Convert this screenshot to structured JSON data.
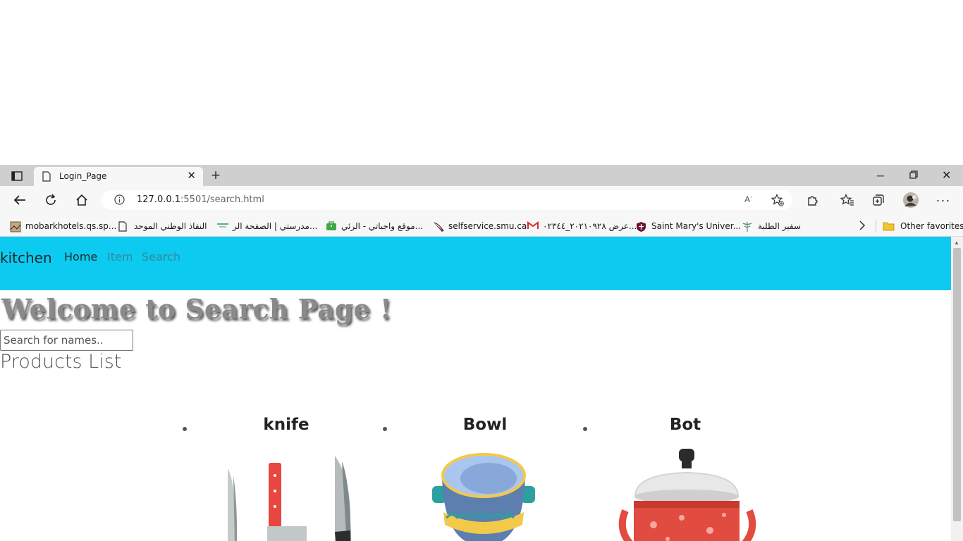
{
  "browser": {
    "tab_title": "Login_Page",
    "url_host": "127.0.0.1",
    "url_path": ":5501/search.html",
    "read_aloud": "Aʾ",
    "bookmarks": [
      {
        "label": "mobarkhotels.qs.sp...",
        "icon": "image-icon"
      },
      {
        "label": "النفاذ الوطني الموحد",
        "icon": "page-icon"
      },
      {
        "label": "مدرستي | الصفحة الر...",
        "icon": "school-icon"
      },
      {
        "label": "موقع واجباتي - الرئي...",
        "icon": "briefcase-icon"
      },
      {
        "label": "selfservice.smu.ca",
        "icon": "feather-icon"
      },
      {
        "label": "عرض ٢٠٢١٠٩٢٨_٠٢٣٤٤...",
        "icon": "gmail-icon"
      },
      {
        "label": "Saint Mary's Univer...",
        "icon": "shield-icon"
      },
      {
        "label": "سفير الطلبة",
        "icon": "caduceus-icon"
      }
    ],
    "other_favorites": "Other favorites"
  },
  "page": {
    "brand": "kitchen",
    "nav": [
      "Home",
      "Item",
      "Search"
    ],
    "welcome": "Welcome to Search Page !",
    "search_placeholder": "Search for names..",
    "products_title": "Products List",
    "products": [
      {
        "name": "knife",
        "image": "knives"
      },
      {
        "name": "Bowl",
        "image": "bowl"
      },
      {
        "name": "Bot",
        "image": "pot"
      }
    ]
  },
  "colors": {
    "navbar": "#0dcaf0",
    "tabstrip": "#cfcfcf",
    "toolbar": "#f7f7f7"
  }
}
